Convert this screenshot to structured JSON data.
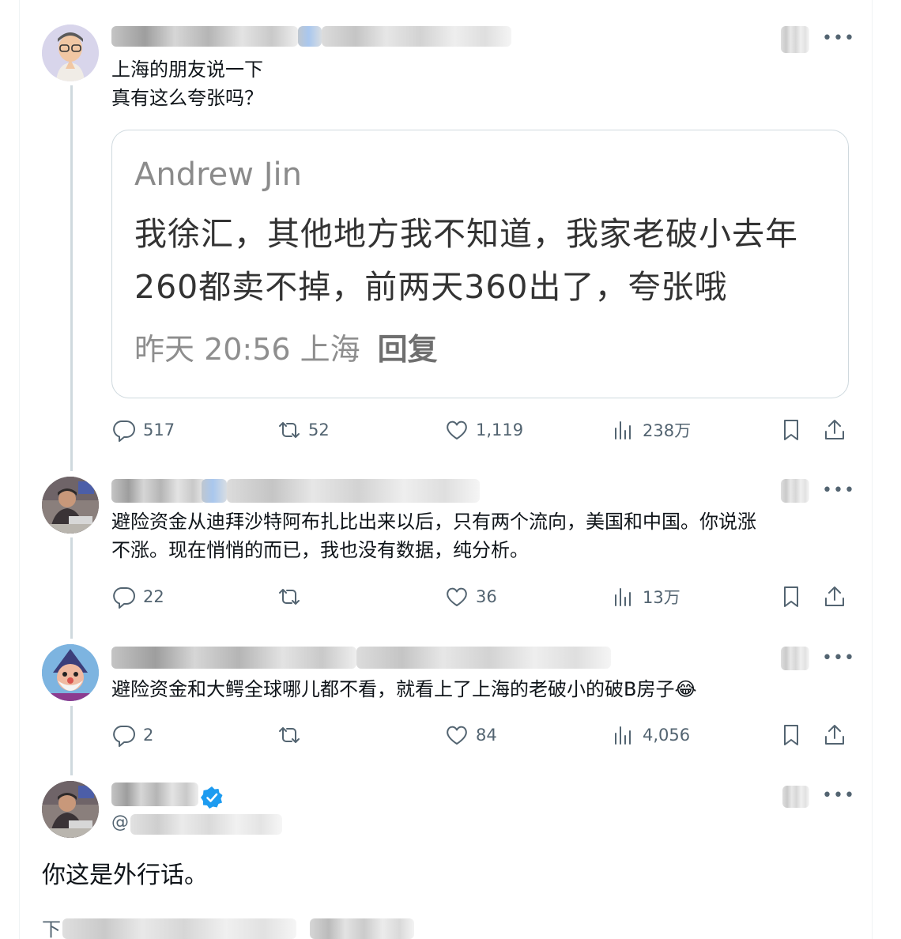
{
  "post1": {
    "text": "上海的朋友说一下\n真有这么夸张吗？",
    "quote": {
      "author": "Andrew Jin",
      "body": "我徐汇，其他地方我不知道，我家老破小去年\n260都卖不掉，前两天360出了，夸张哦",
      "meta": "昨天 20:56 上海",
      "reply": "回复"
    },
    "stats": {
      "replies": "517",
      "reposts": "52",
      "likes": "1,119",
      "views": "238万"
    }
  },
  "post2": {
    "text": "避险资金从迪拜沙特阿布扎比出来以后，只有两个流向，美国和中国。你说涨\n不涨。现在悄悄的而已，我也没有数据，纯分析。",
    "stats": {
      "replies": "22",
      "reposts": "",
      "likes": "36",
      "views": "13万"
    }
  },
  "post3": {
    "text": "避险资金和大鳄全球哪儿都不看，就看上了上海的老破小的破B房子😂",
    "stats": {
      "replies": "2",
      "reposts": "",
      "likes": "84",
      "views": "4,056"
    }
  },
  "main": {
    "handle_prefix": "@",
    "text": "你这是外行话。",
    "meta_prefix": "下"
  },
  "icons": {
    "reply": "speech-bubble-icon",
    "repost": "repost-arrows-icon",
    "like": "heart-icon",
    "views": "bar-chart-icon",
    "bookmark": "bookmark-icon",
    "share": "share-upload-icon",
    "more": "more-dots-icon",
    "verified": "verified-badge-icon"
  },
  "colors": {
    "accent": "#1d9bf0",
    "muted": "#536471",
    "line": "#cfd9de"
  }
}
